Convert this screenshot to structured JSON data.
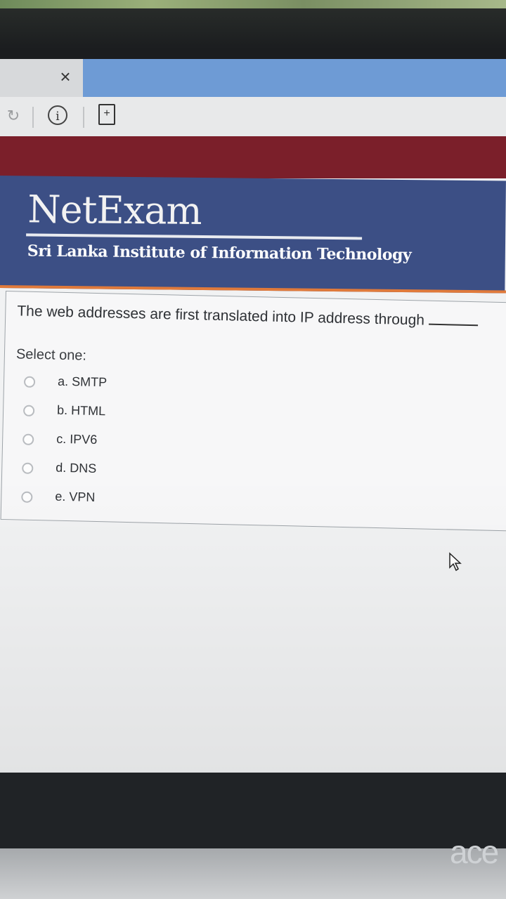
{
  "browser": {
    "tab_close_glyph": "×",
    "reload_glyph": "↻",
    "info_glyph": "i",
    "page_add_glyph": "+"
  },
  "site": {
    "brand": "NetExam",
    "institution": "Sri Lanka Institute of Information Technology"
  },
  "quiz": {
    "question": "The web addresses are first translated into IP address through",
    "select_label": "Select one:",
    "options": [
      {
        "label": "a. SMTP",
        "selected": false
      },
      {
        "label": "b. HTML",
        "selected": false
      },
      {
        "label": "c. IPV6",
        "selected": false
      },
      {
        "label": "d. DNS",
        "selected": false
      },
      {
        "label": "e. VPN",
        "selected": false
      }
    ]
  },
  "device": {
    "logo_text": "ace"
  },
  "colors": {
    "maroon": "#7b1f2a",
    "banner_blue": "#3c4f85",
    "accent_orange": "#e07a3b",
    "tab_blue": "#6e9bd5"
  },
  "icons": [
    "close-icon",
    "reload-icon",
    "info-icon",
    "page-add-icon",
    "mouse-cursor-icon"
  ]
}
